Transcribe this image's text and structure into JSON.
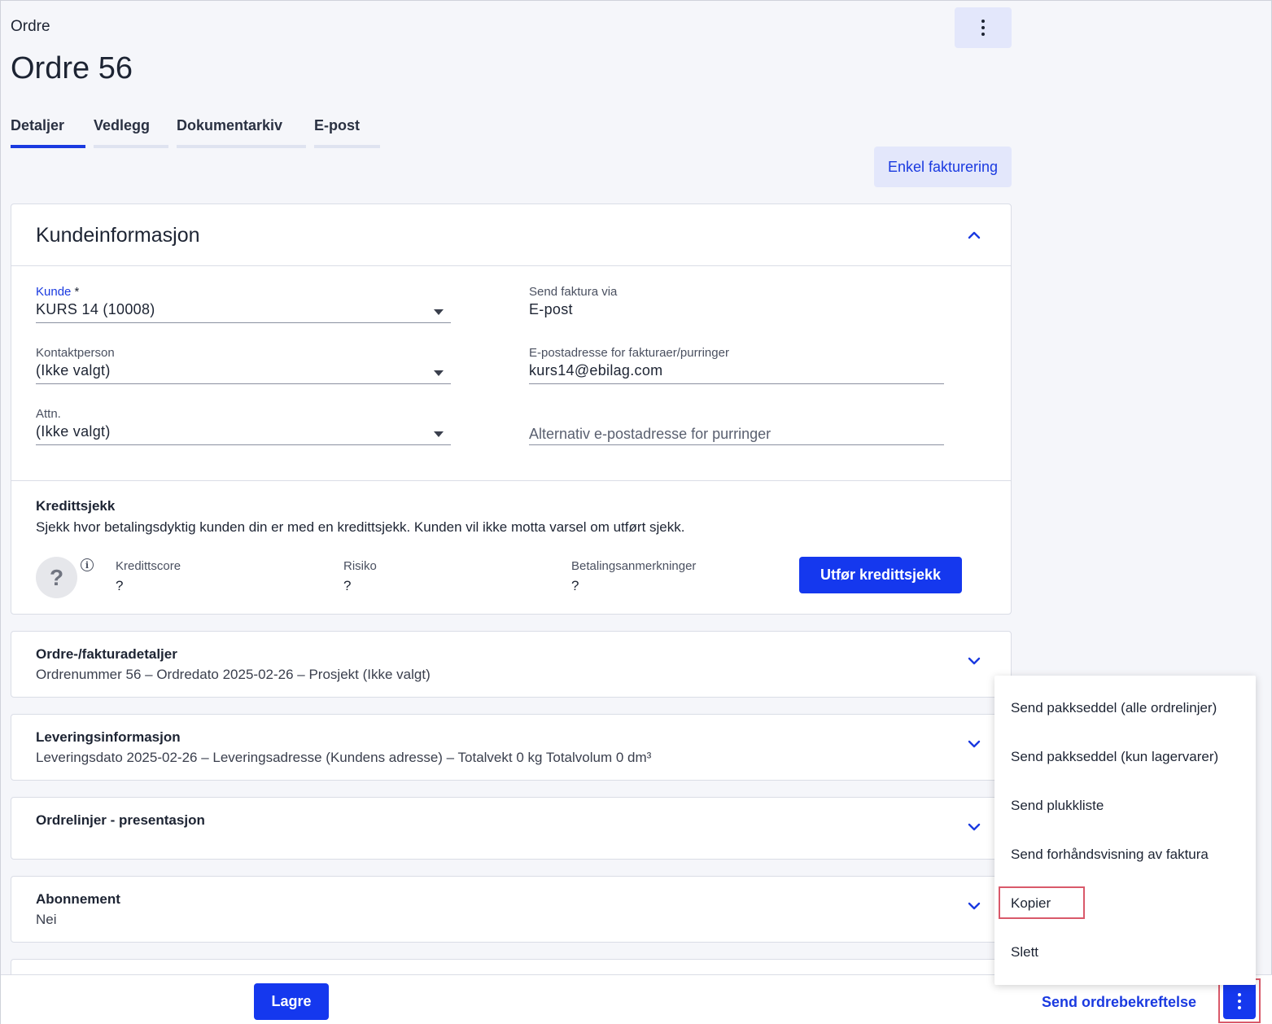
{
  "header": {
    "breadcrumb": "Ordre",
    "title": "Ordre 56"
  },
  "tabs": [
    {
      "label": "Detaljer",
      "active": true
    },
    {
      "label": "Vedlegg",
      "active": false
    },
    {
      "label": "Dokumentarkiv",
      "active": false
    },
    {
      "label": "E-post",
      "active": false
    }
  ],
  "actions": {
    "simple_invoicing": "Enkel fakturering"
  },
  "customer_info": {
    "title": "Kundeinformasjon",
    "kunde": {
      "label": "Kunde",
      "required_mark": "*",
      "value": "KURS 14 (10008)"
    },
    "kontaktperson": {
      "label": "Kontaktperson",
      "value": "(Ikke valgt)"
    },
    "attn": {
      "label": "Attn.",
      "value": "(Ikke valgt)"
    },
    "send_invoice_via": {
      "label": "Send faktura via",
      "value": "E-post"
    },
    "invoice_email": {
      "label": "E-postadresse for fakturaer/purringer",
      "value": "kurs14@ebilag.com"
    },
    "alt_email": {
      "placeholder": "Alternativ e-postadresse for purringer"
    }
  },
  "credit_check": {
    "title": "Kredittsjekk",
    "description": "Sjekk hvor betalingsdyktig kunden din er med en kredittsjekk. Kunden vil ikke motta varsel om utført sjekk.",
    "icon_text": "?",
    "info_icon_text": "i",
    "score": {
      "label": "Kredittscore",
      "value": "?"
    },
    "risk": {
      "label": "Risiko",
      "value": "?"
    },
    "remarks": {
      "label": "Betalingsanmerkninger",
      "value": "?"
    },
    "button": "Utfør kredittsjekk"
  },
  "sections": [
    {
      "title": "Ordre-/fakturadetaljer",
      "summary": "Ordrenummer 56  –  Ordredato 2025-02-26  –  Prosjekt (Ikke valgt)"
    },
    {
      "title": "Leveringsinformasjon",
      "summary": "Leveringsdato 2025-02-26  –  Leveringsadresse (Kundens adresse)  –  Totalvekt 0 kg Totalvolum 0 dm³"
    },
    {
      "title": "Ordrelinjer - presentasjon",
      "summary": ""
    },
    {
      "title": "Abonnement",
      "summary": "Nei"
    }
  ],
  "footer": {
    "save": "Lagre",
    "send_confirmation": "Send ordrebekreftelse"
  },
  "menu": {
    "items": [
      "Send pakkseddel (alle ordrelinjer)",
      "Send pakkseddel (kun lagervarer)",
      "Send plukkliste",
      "Send forhåndsvisning av faktura",
      "Kopier",
      "Slett"
    ],
    "highlighted": "Kopier"
  },
  "colors": {
    "accent": "#1538ee",
    "highlight_border": "#d9596a",
    "light_button_bg": "#e3e7fb"
  }
}
